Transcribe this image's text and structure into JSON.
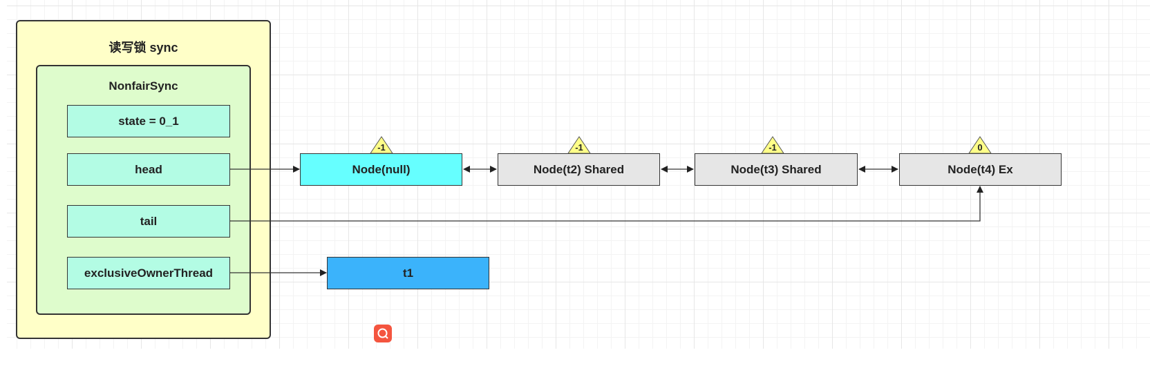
{
  "outer": {
    "title": "读写锁 sync",
    "fill": "#ffffc8"
  },
  "inner": {
    "title": "NonfairSync",
    "fill": "#defccc"
  },
  "fields": [
    "state = 0_1",
    "head",
    "tail",
    "exclusiveOwnerThread"
  ],
  "field_fill": "#b3fce4",
  "nodes": [
    {
      "label": "Node(null)",
      "waitStatus": "-1",
      "fill": "#66ffff"
    },
    {
      "label": "Node(t2) Shared",
      "waitStatus": "-1",
      "fill": "#e6e6e6"
    },
    {
      "label": "Node(t3) Shared",
      "waitStatus": "-1",
      "fill": "#e6e6e6"
    },
    {
      "label": "Node(t4) Ex",
      "waitStatus": "0",
      "fill": "#e6e6e6"
    }
  ],
  "owner": {
    "label": "t1",
    "fill": "#3bb3fb"
  },
  "triangle_fill": "#ffff88",
  "search_icon": "search-icon"
}
